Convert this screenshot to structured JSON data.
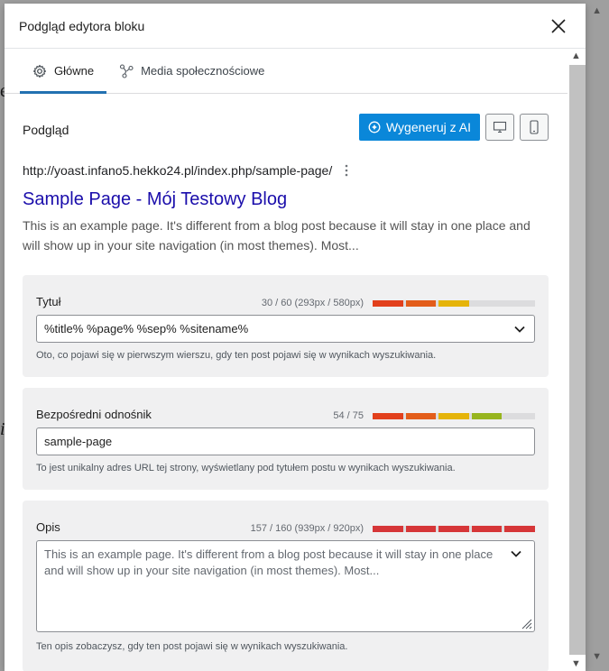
{
  "modal": {
    "title": "Podgląd edytora bloku"
  },
  "tabs": [
    {
      "label": "Główne",
      "active": true
    },
    {
      "label": "Media społecznościowe",
      "active": false
    }
  ],
  "preview": {
    "label": "Podgląd",
    "ai_button": "Wygeneruj z AI",
    "url": "http://yoast.infano5.hekko24.pl/index.php/sample-page/",
    "title": "Sample Page - Mój Testowy Blog",
    "description": "This is an example page. It's different from a blog post because it will stay in one place and will show up in your site navigation (in most themes). Most..."
  },
  "fields": {
    "title": {
      "label": "Tytuł",
      "meter_text": "30 / 60 (293px / 580px)",
      "value": "%title% %page% %sep% %sitename%",
      "hint": "Oto, co pojawi się w pierwszym wierszu, gdy ten post pojawi się w wynikach wyszukiwania.",
      "progress": 0.5,
      "colors": [
        "#e2401c",
        "#e35d1a",
        "#e5b40a"
      ]
    },
    "slug": {
      "label": "Bezpośredni odnośnik",
      "meter_text": "54 / 75",
      "value": "sample-page",
      "hint": "To jest unikalny adres URL tej strony, wyświetlany pod tytułem postu w wynikach wyszukiwania.",
      "progress": 0.72,
      "colors": [
        "#e2401c",
        "#e35d1a",
        "#e5b40a",
        "#97b51e"
      ]
    },
    "description": {
      "label": "Opis",
      "meter_text": "157 / 160 (939px / 920px)",
      "value": "This is an example page. It's different from a blog post because it will stay in one place and will show up in your site navigation (in most themes). Most...",
      "hint": "Ten opis zobaczysz, gdy ten post pojawi się w wynikach wyszukiwania.",
      "progress": 1.0,
      "colors": [
        "#d63638",
        "#d63638",
        "#d63638",
        "#d63638",
        "#d63638"
      ]
    }
  },
  "icons": {
    "close": "close-icon",
    "gear": "gear-icon",
    "share": "share-icon",
    "ai": "ai-spark-icon",
    "desktop": "desktop-icon",
    "mobile": "mobile-icon",
    "more": "more-vertical-icon",
    "chevron": "chevron-down-icon"
  }
}
